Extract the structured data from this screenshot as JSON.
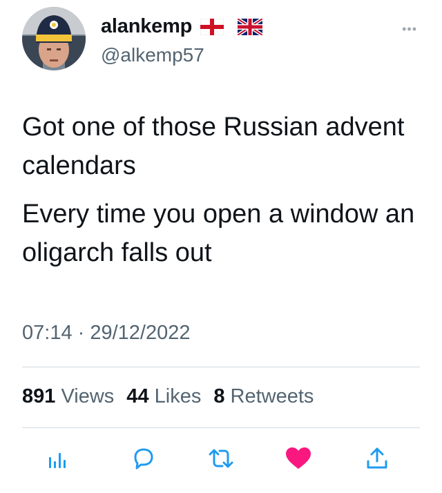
{
  "author": {
    "display_name": "alankemp",
    "handle": "@alkemp57",
    "flags": [
      "england-flag-icon",
      "uk-flag-icon"
    ]
  },
  "tweet": {
    "paragraphs": [
      "Got one of those Russian advent calendars",
      "Every time you open a window an oligarch falls out"
    ],
    "timestamp": "07:14 · 29/12/2022"
  },
  "stats": {
    "views_count": "891",
    "views_label": "Views",
    "likes_count": "44",
    "likes_label": "Likes",
    "retweets_count": "8",
    "retweets_label": "Retweets"
  },
  "actions": [
    "views-icon",
    "reply-icon",
    "retweet-icon",
    "like-icon",
    "share-icon"
  ],
  "colors": {
    "text_primary": "#0f1419",
    "text_secondary": "#536471",
    "accent_blue": "#1d9bf0",
    "like_pink": "#f91880",
    "divider": "#cfd9de"
  }
}
